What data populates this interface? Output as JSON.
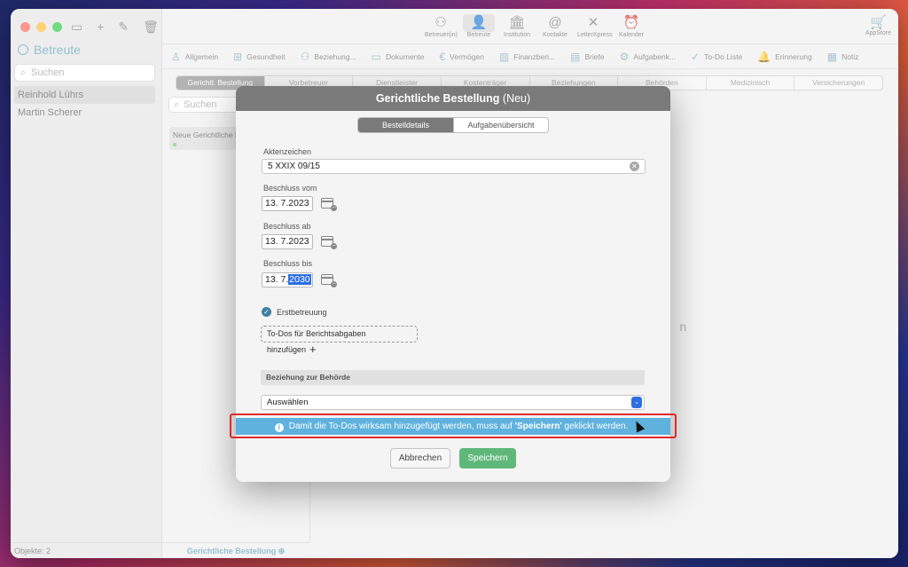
{
  "sidebar": {
    "title": "Betreute",
    "search_placeholder": "Suchen",
    "items": [
      {
        "label": "Reinhold Lührs"
      },
      {
        "label": "Martin Scherer"
      }
    ],
    "footer": "Objekte: 2"
  },
  "toolbar": {
    "buttons": [
      {
        "label": "Betreuer(in)",
        "icon": "people-icon"
      },
      {
        "label": "Betreute",
        "icon": "person-icon"
      },
      {
        "label": "Institution",
        "icon": "building-icon"
      },
      {
        "label": "Kontakte",
        "icon": "at-icon"
      },
      {
        "label": "LetterXpress",
        "icon": "letterxpress-icon"
      },
      {
        "label": "Kalender",
        "icon": "alarm-icon"
      }
    ],
    "appstore": "AppStore"
  },
  "detail_tabs": [
    {
      "label": "Allgemein"
    },
    {
      "label": "Gesundheit"
    },
    {
      "label": "Beziehung..."
    },
    {
      "label": "Dokumente"
    },
    {
      "label": "Vermögen"
    },
    {
      "label": "Finanzberi..."
    },
    {
      "label": "Briefe"
    },
    {
      "label": "Aufgabenk..."
    },
    {
      "label": "To-Do Liste"
    },
    {
      "label": "Erinnerung"
    },
    {
      "label": "Notiz"
    }
  ],
  "segments": [
    "Gerichtl. Bestellung",
    "Vorbetreuer",
    "Dienstleister",
    "Kostenträger",
    "Beziehungen",
    "Behörden",
    "Medizinisch",
    "Versicherungen"
  ],
  "sub": {
    "search_placeholder": "Suchen",
    "item": "Neue Gerichtliche B",
    "footer": "Gerichtliche Bestellung"
  },
  "ghost_text": "n",
  "dialog": {
    "title_bold": "Gerichtliche Bestellung",
    "title_suffix": " (Neu)",
    "tabs": [
      "Bestelldetails",
      "Aufgabenübersicht"
    ],
    "aktenzeichen_label": "Aktenzeichen",
    "aktenzeichen_value": "5 XXIX 09/15",
    "beschluss_vom_label": "Beschluss vom",
    "beschluss_vom_value": "13.  7.2023",
    "beschluss_ab_label": "Beschluss ab",
    "beschluss_ab_value": "13.  7.2023",
    "beschluss_bis_label": "Beschluss bis",
    "beschluss_bis_prefix": "13.  7.",
    "beschluss_bis_year": "2030",
    "erstbetreuung_label": "Erstbetreuung",
    "todo_button": "To-Dos für Berichtsabgaben hinzufügen",
    "section_title": "Beziehung zur Behörde",
    "select_value": "Auswählen",
    "info_pre": "Damit die To-Dos wirksam hinzugefügt werden, muss auf ",
    "info_bold": "'Speichern'",
    "info_post": " geklickt werden.",
    "cancel_label": "Abbrechen",
    "save_label": "Speichern"
  }
}
